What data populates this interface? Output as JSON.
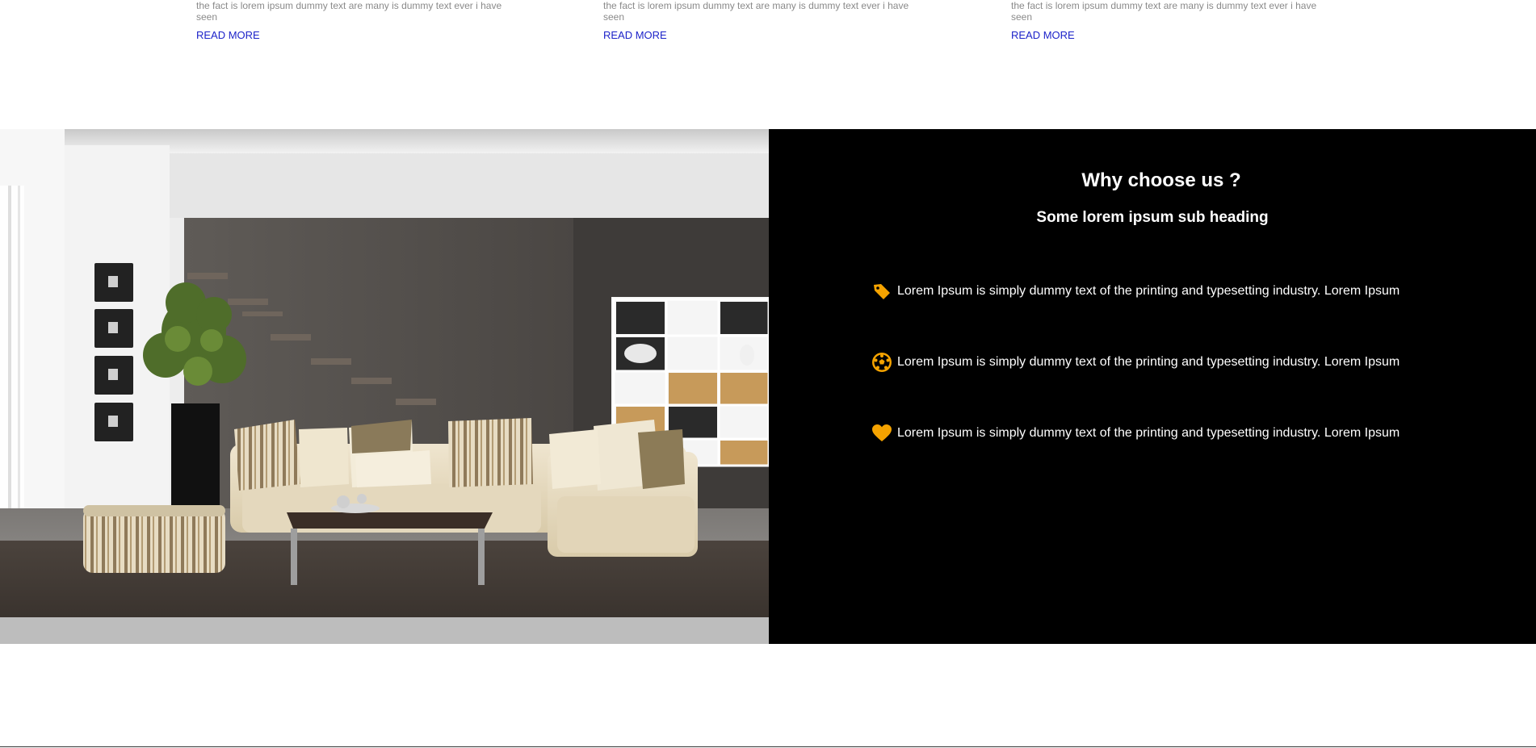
{
  "blog": {
    "columns": [
      {
        "excerpt": "There are many variations of passages of Lorem Ipsum text available, but the fact is lorem ipsum dummy text are many is dummy text ever i have seen",
        "read_more": "READ MORE"
      },
      {
        "excerpt": "There are many variations of passages of Lorem Ipsum text available, but the fact is lorem ipsum dummy text are many is dummy text ever i have seen",
        "read_more": "READ MORE"
      },
      {
        "excerpt": "There are many variations of passages of Lorem Ipsum text available, but the fact is lorem ipsum dummy text are many is dummy text ever i have seen",
        "read_more": "READ MORE"
      }
    ]
  },
  "why": {
    "title": "Why choose us ?",
    "subtitle": "Some lorem ipsum sub heading",
    "items": [
      {
        "icon": "tag-icon",
        "text": "Lorem Ipsum is simply dummy text of the printing and typesetting industry. Lorem Ipsum"
      },
      {
        "icon": "soccer-ball-icon",
        "text": "Lorem Ipsum is simply dummy text of the printing and typesetting industry. Lorem Ipsum"
      },
      {
        "icon": "heart-icon",
        "text": "Lorem Ipsum is simply dummy text of the printing and typesetting industry. Lorem Ipsum"
      }
    ]
  },
  "colors": {
    "accent": "#f5a300",
    "link": "#1d23c9",
    "band_bg": "#000000"
  }
}
